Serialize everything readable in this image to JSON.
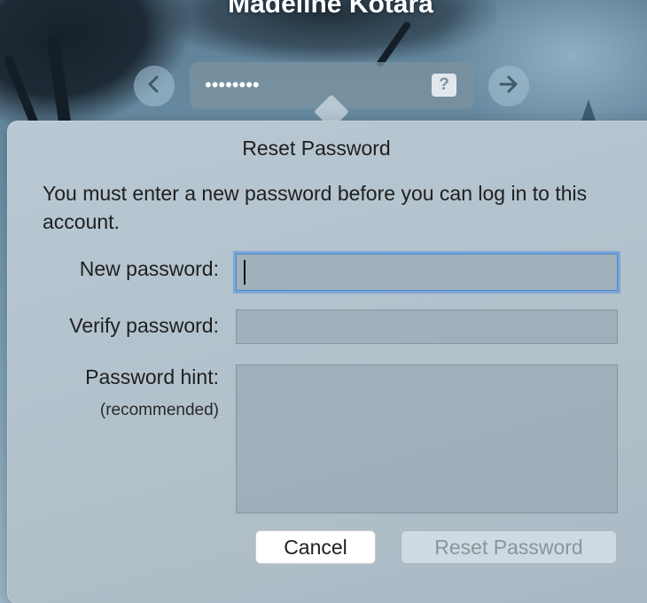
{
  "user": {
    "name": "Madeline Kotara"
  },
  "password_field": {
    "masked_value": "••••••••"
  },
  "dialog": {
    "title": "Reset Password",
    "message": "You must enter a new password before you can log in to this account.",
    "fields": {
      "new_password": {
        "label": "New password:",
        "value": ""
      },
      "verify_password": {
        "label": "Verify password:",
        "value": ""
      },
      "password_hint": {
        "label": "Password hint:",
        "sublabel": "(recommended)",
        "value": ""
      }
    },
    "buttons": {
      "cancel": "Cancel",
      "reset": "Reset Password"
    }
  },
  "icons": {
    "back": "chevron-left-icon",
    "forward": "arrow-right-icon",
    "hint": "question-mark-icon"
  },
  "colors": {
    "focus_ring": "#4a88d6",
    "dialog_bg": "#b5c4ce",
    "disabled_text": "#8a949b"
  }
}
